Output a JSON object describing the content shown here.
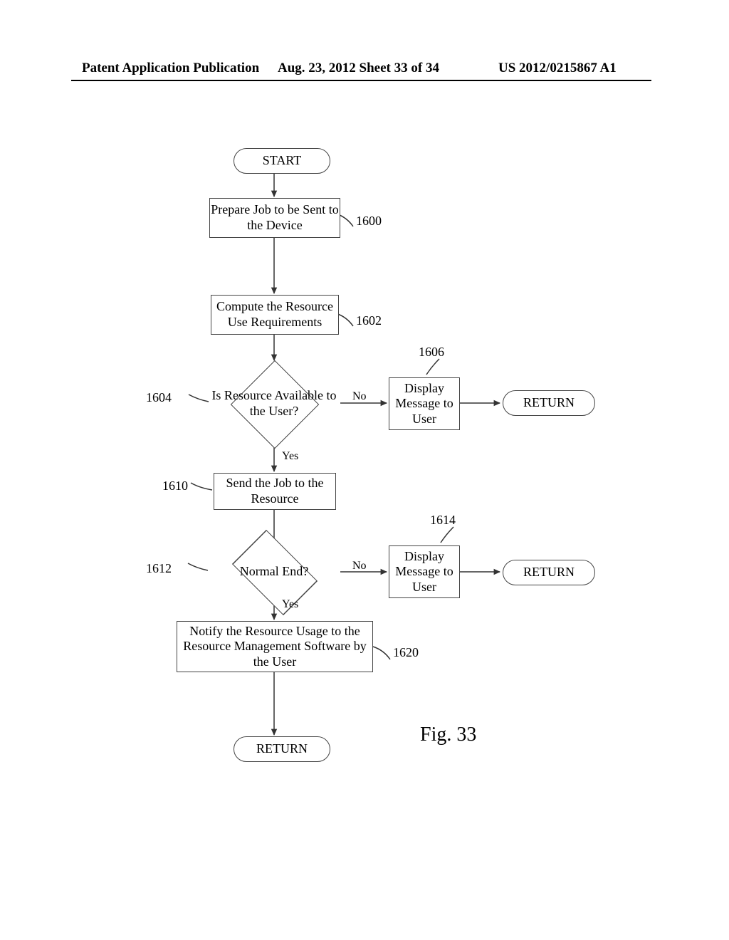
{
  "header": {
    "left": "Patent Application Publication",
    "middle": "Aug. 23, 2012  Sheet 33 of 34",
    "right": "US 2012/0215867 A1"
  },
  "nodes": {
    "start": "START",
    "prepare": "Prepare Job to be Sent to the Device",
    "compute": "Compute the Resource Use Requirements",
    "resource_q": "Is Resource Available to the User?",
    "display_msg": "Display Message to User",
    "send_job": "Send the Job to the Resource",
    "normal_end_q": "Normal End?",
    "display_msg2": "Display Message to User",
    "notify": "Notify the Resource Usage to the Resource Management Software by the User",
    "return": "RETURN",
    "return2": "RETURN",
    "return3": "RETURN"
  },
  "refs": {
    "r1600": "1600",
    "r1602": "1602",
    "r1604": "1604",
    "r1606": "1606",
    "r1610": "1610",
    "r1612": "1612",
    "r1614": "1614",
    "r1620": "1620"
  },
  "labels": {
    "yes": "Yes",
    "no": "No"
  },
  "figure_caption": "Fig. 33"
}
